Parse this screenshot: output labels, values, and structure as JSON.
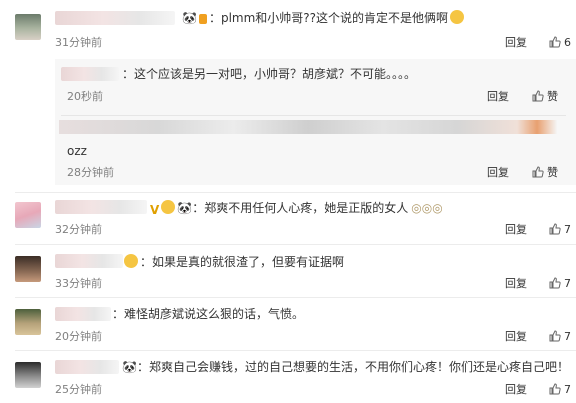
{
  "comments": [
    {
      "text": "：plmm和小帅哥??这个说的肯定不是他俩啊",
      "time": "31分钟前",
      "reply": "回复",
      "like_count": "6",
      "replies": [
        {
          "text": "：这个应该是另一对吧，小帅哥？胡彦斌？不可能。。。。",
          "time": "20秒前",
          "reply": "回复",
          "like": "赞"
        },
        {
          "text": "ozz",
          "time": "28分钟前",
          "reply": "回复",
          "like": "赞"
        }
      ]
    },
    {
      "text": "：郑爽不用任何人心疼，她是正版的女人",
      "time": "32分钟前",
      "reply": "回复",
      "like_count": "7"
    },
    {
      "text": "：如果是真的就很渣了，但要有证据啊",
      "time": "33分钟前",
      "reply": "回复",
      "like_count": "7"
    },
    {
      "text": "：难怪胡彦斌说这么狠的话，气愤。",
      "time": "20分钟前",
      "reply": "回复",
      "like_count": "7"
    },
    {
      "text": "：郑爽自己会赚钱，过的自己想要的生活，不用你们心疼！你们还是心疼自己吧！",
      "time": "25分钟前",
      "reply": "回复",
      "like_count": "7"
    }
  ],
  "colors": {
    "muted": "#808080",
    "text": "#333333",
    "divider": "#ececec",
    "subbox": "#f7f7f7",
    "emoji": "#f5c542"
  },
  "icons": [
    "thumbs-up-icon",
    "panda-badge-icon",
    "laughing-emoji-icon",
    "v-badge-icon",
    "eye-emoji-icon"
  ]
}
